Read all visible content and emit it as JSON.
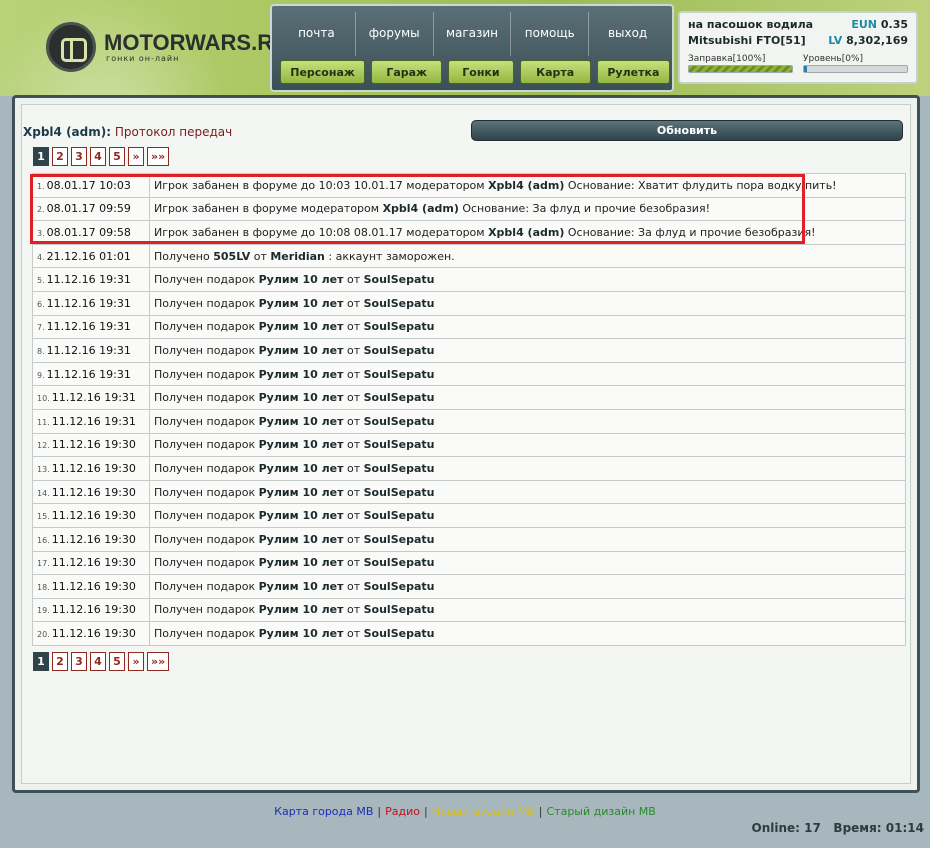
{
  "logo": {
    "title": "MOTORWARS.RU",
    "subtitle": "гонки он-лайн"
  },
  "menu": {
    "top": [
      "почта",
      "форумы",
      "магазин",
      "помощь",
      "выход"
    ],
    "bottom": [
      "Персонаж",
      "Гараж",
      "Гонки",
      "Карта",
      "Рулетка"
    ]
  },
  "status": {
    "player": "на пасошок водила",
    "car": "Mitsubishi FTO[51]",
    "eun_label": "EUN",
    "eun_value": "0.35",
    "lv_label": "LV",
    "lv_value": "8,302,169",
    "fuel_label": "Заправка[100%]",
    "fuel_fraction": 1.0,
    "level_label": "Уровень[0%]",
    "level_fraction": 0.0
  },
  "page": {
    "who": "Xpbl4 (adm)",
    "colon": ":",
    "title": "Протокол передач",
    "refresh": "Обновить"
  },
  "pager": [
    "1",
    "2",
    "3",
    "4",
    "5",
    "»",
    "»»"
  ],
  "colors": {
    "highlight": "#e01f26",
    "accent": "#2e434a",
    "brand_green": "#93b741"
  },
  "log": [
    {
      "n": "1.",
      "date": "08.01.17 10:03",
      "parts": [
        [
          "Игрок забанен в форуме до 10:03 10.01.17 модератором ",
          0
        ],
        [
          "Xpbl4 (adm)",
          1
        ],
        [
          " Основание: Хватит флудить пора водку пить!",
          0
        ]
      ]
    },
    {
      "n": "2.",
      "date": "08.01.17 09:59",
      "parts": [
        [
          "Игрок забанен в форуме модератором ",
          0
        ],
        [
          "Xpbl4 (adm)",
          1
        ],
        [
          " Основание: За флуд и прочие безобразия!",
          0
        ]
      ]
    },
    {
      "n": "3.",
      "date": "08.01.17 09:58",
      "parts": [
        [
          "Игрок забанен в форуме до 10:08 08.01.17 модератором ",
          0
        ],
        [
          "Xpbl4 (adm)",
          1
        ],
        [
          " Основание: За флуд и прочие безобразия!",
          0
        ]
      ]
    },
    {
      "n": "4.",
      "date": "21.12.16 01:01",
      "parts": [
        [
          "Получено ",
          0
        ],
        [
          "505LV",
          1
        ],
        [
          " от ",
          0
        ],
        [
          "Meridian",
          1
        ],
        [
          " : аккаунт заморожен.",
          0
        ]
      ]
    },
    {
      "n": "5.",
      "date": "11.12.16 19:31",
      "parts": [
        [
          "Получен подарок ",
          0
        ],
        [
          "Рулим 10 лет",
          1
        ],
        [
          " от ",
          0
        ],
        [
          "SoulSepatu",
          1
        ]
      ]
    },
    {
      "n": "6.",
      "date": "11.12.16 19:31",
      "parts": [
        [
          "Получен подарок ",
          0
        ],
        [
          "Рулим 10 лет",
          1
        ],
        [
          " от ",
          0
        ],
        [
          "SoulSepatu",
          1
        ]
      ]
    },
    {
      "n": "7.",
      "date": "11.12.16 19:31",
      "parts": [
        [
          "Получен подарок ",
          0
        ],
        [
          "Рулим 10 лет",
          1
        ],
        [
          " от ",
          0
        ],
        [
          "SoulSepatu",
          1
        ]
      ]
    },
    {
      "n": "8.",
      "date": "11.12.16 19:31",
      "parts": [
        [
          "Получен подарок ",
          0
        ],
        [
          "Рулим 10 лет",
          1
        ],
        [
          " от ",
          0
        ],
        [
          "SoulSepatu",
          1
        ]
      ]
    },
    {
      "n": "9.",
      "date": "11.12.16 19:31",
      "parts": [
        [
          "Получен подарок ",
          0
        ],
        [
          "Рулим 10 лет",
          1
        ],
        [
          " от ",
          0
        ],
        [
          "SoulSepatu",
          1
        ]
      ]
    },
    {
      "n": "10.",
      "date": "11.12.16 19:31",
      "parts": [
        [
          "Получен подарок ",
          0
        ],
        [
          "Рулим 10 лет",
          1
        ],
        [
          " от ",
          0
        ],
        [
          "SoulSepatu",
          1
        ]
      ]
    },
    {
      "n": "11.",
      "date": "11.12.16 19:31",
      "parts": [
        [
          "Получен подарок ",
          0
        ],
        [
          "Рулим 10 лет",
          1
        ],
        [
          " от ",
          0
        ],
        [
          "SoulSepatu",
          1
        ]
      ]
    },
    {
      "n": "12.",
      "date": "11.12.16 19:30",
      "parts": [
        [
          "Получен подарок ",
          0
        ],
        [
          "Рулим 10 лет",
          1
        ],
        [
          " от ",
          0
        ],
        [
          "SoulSepatu",
          1
        ]
      ]
    },
    {
      "n": "13.",
      "date": "11.12.16 19:30",
      "parts": [
        [
          "Получен подарок ",
          0
        ],
        [
          "Рулим 10 лет",
          1
        ],
        [
          " от ",
          0
        ],
        [
          "SoulSepatu",
          1
        ]
      ]
    },
    {
      "n": "14.",
      "date": "11.12.16 19:30",
      "parts": [
        [
          "Получен подарок ",
          0
        ],
        [
          "Рулим 10 лет",
          1
        ],
        [
          " от ",
          0
        ],
        [
          "SoulSepatu",
          1
        ]
      ]
    },
    {
      "n": "15.",
      "date": "11.12.16 19:30",
      "parts": [
        [
          "Получен подарок ",
          0
        ],
        [
          "Рулим 10 лет",
          1
        ],
        [
          " от ",
          0
        ],
        [
          "SoulSepatu",
          1
        ]
      ]
    },
    {
      "n": "16.",
      "date": "11.12.16 19:30",
      "parts": [
        [
          "Получен подарок ",
          0
        ],
        [
          "Рулим 10 лет",
          1
        ],
        [
          " от ",
          0
        ],
        [
          "SoulSepatu",
          1
        ]
      ]
    },
    {
      "n": "17.",
      "date": "11.12.16 19:30",
      "parts": [
        [
          "Получен подарок ",
          0
        ],
        [
          "Рулим 10 лет",
          1
        ],
        [
          " от ",
          0
        ],
        [
          "SoulSepatu",
          1
        ]
      ]
    },
    {
      "n": "18.",
      "date": "11.12.16 19:30",
      "parts": [
        [
          "Получен подарок ",
          0
        ],
        [
          "Рулим 10 лет",
          1
        ],
        [
          " от ",
          0
        ],
        [
          "SoulSepatu",
          1
        ]
      ]
    },
    {
      "n": "19.",
      "date": "11.12.16 19:30",
      "parts": [
        [
          "Получен подарок ",
          0
        ],
        [
          "Рулим 10 лет",
          1
        ],
        [
          " от ",
          0
        ],
        [
          "SoulSepatu",
          1
        ]
      ]
    },
    {
      "n": "20.",
      "date": "11.12.16 19:30",
      "parts": [
        [
          "Получен подарок ",
          0
        ],
        [
          "Рулим 10 лет",
          1
        ],
        [
          " от ",
          0
        ],
        [
          "SoulSepatu",
          1
        ]
      ]
    }
  ],
  "footer": {
    "links": [
      {
        "label": "Карта города МВ",
        "color": "#1b2fb5"
      },
      {
        "label": "Радио",
        "color": "#c0121a"
      },
      {
        "label": "Новый дизайн МВ",
        "color": "#d8c21a"
      },
      {
        "label": "Старый дизайн МВ",
        "color": "#2a8a2a"
      }
    ],
    "separator": "|",
    "online_label": "Online:",
    "online_value": "17",
    "time_label": "Время:",
    "time_value": "01:14"
  }
}
